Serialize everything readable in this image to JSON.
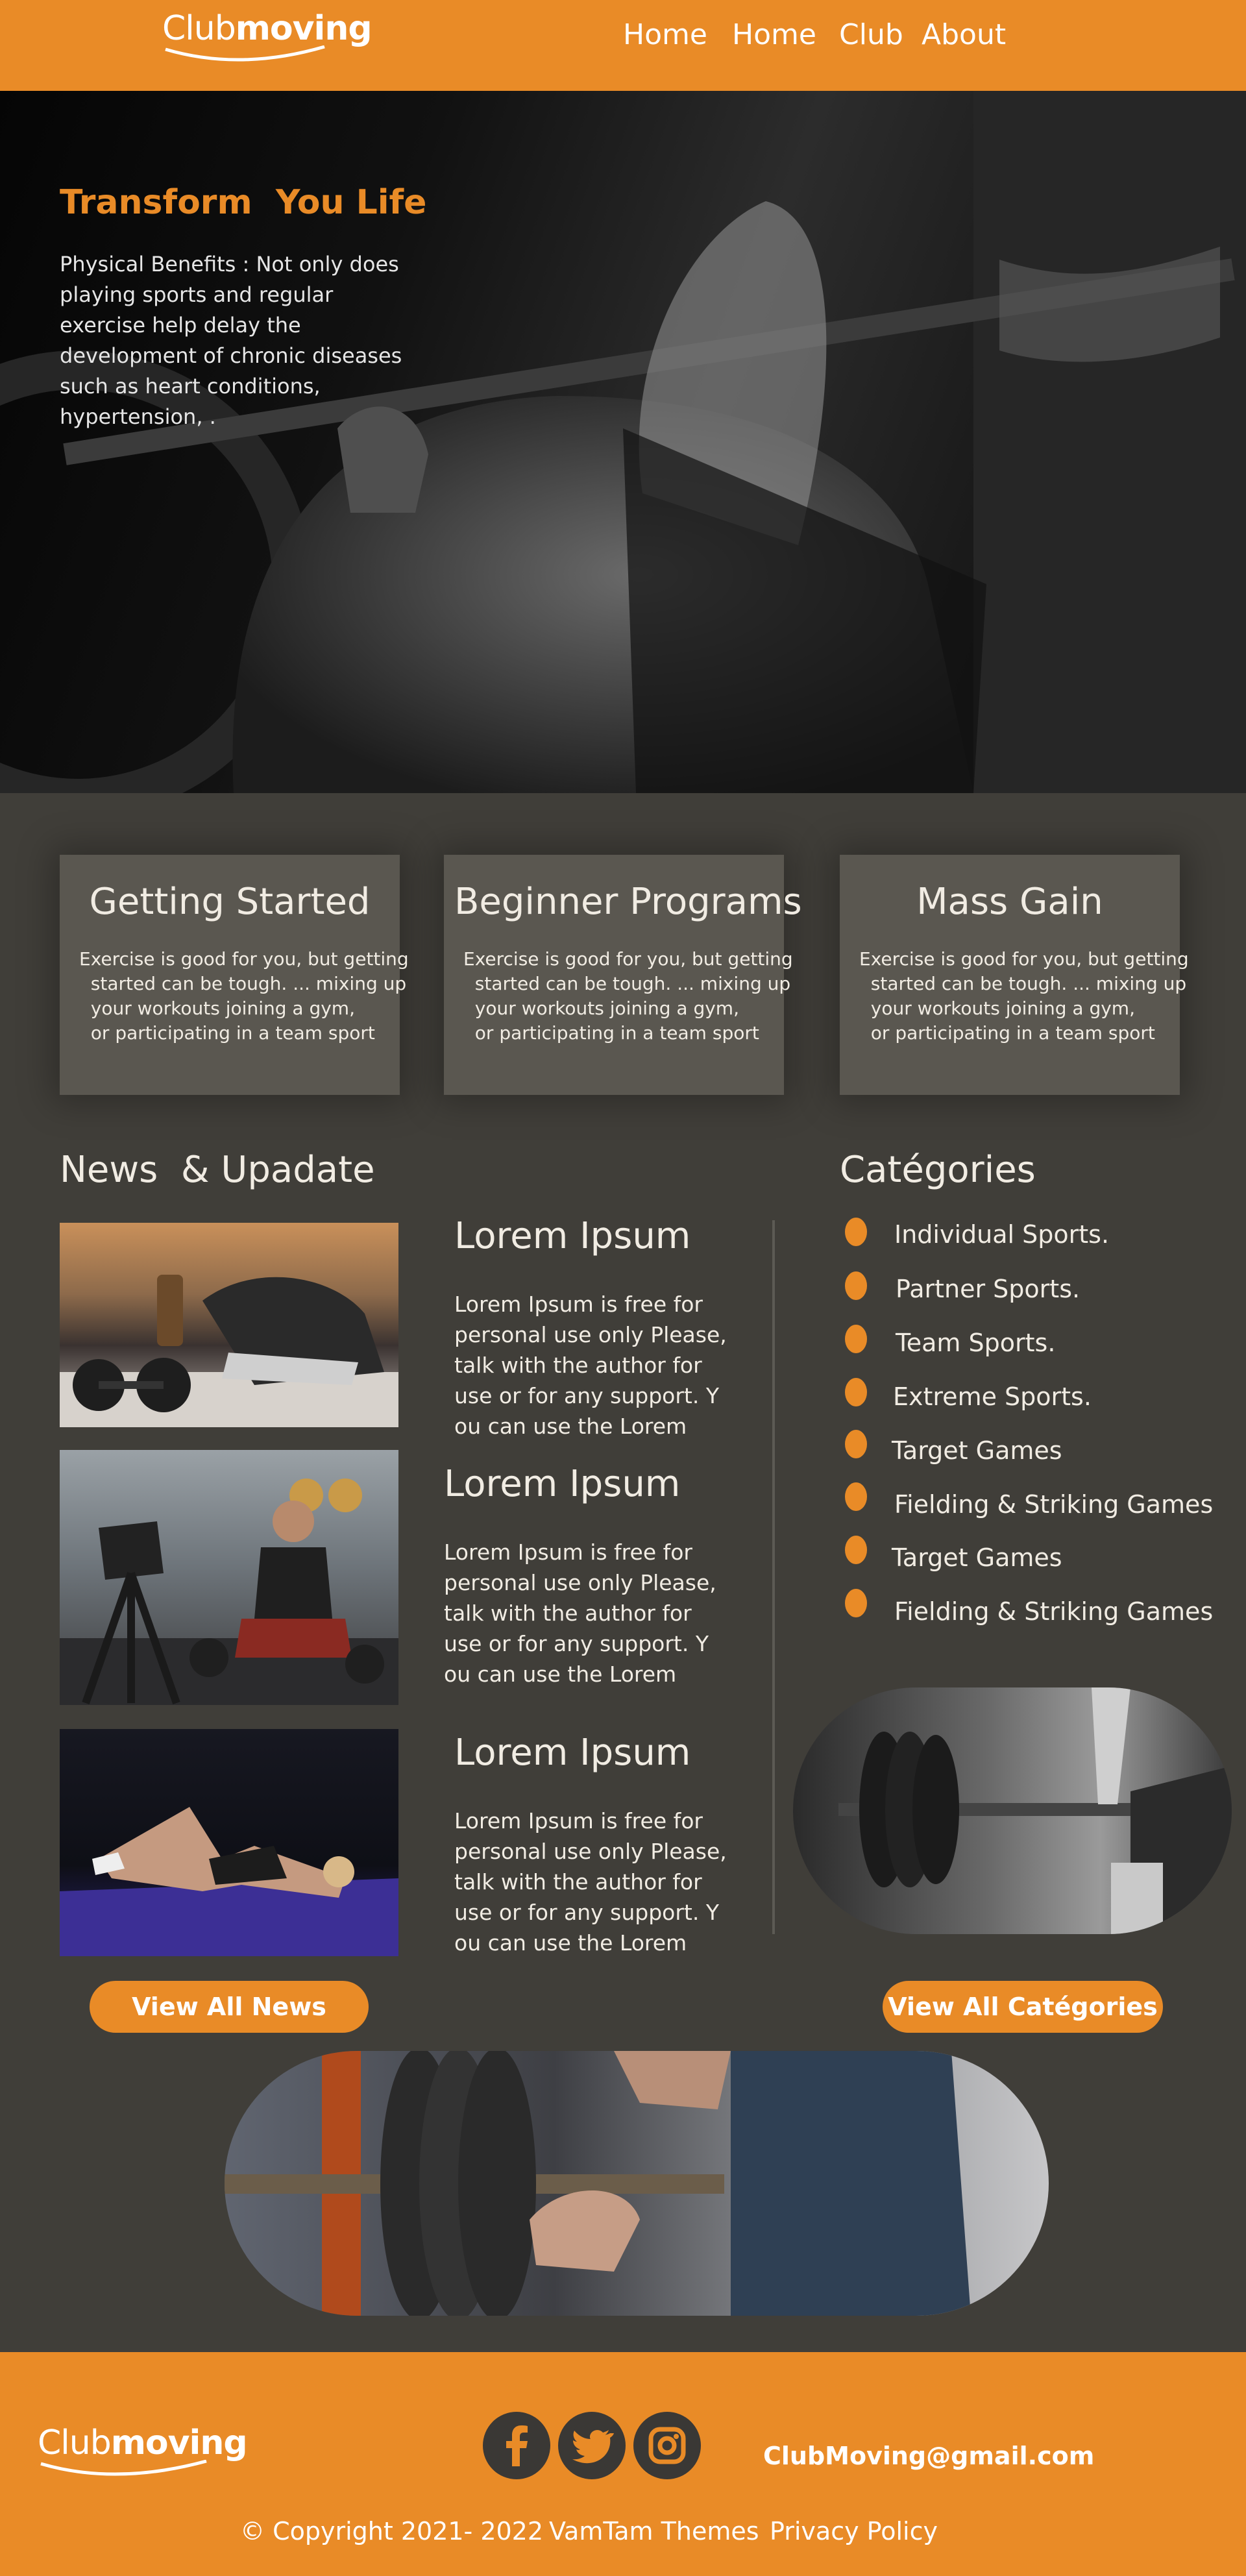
{
  "header": {
    "logo": {
      "thin": "Club",
      "bold": "moving"
    },
    "nav": [
      "Home",
      "Home",
      "Club",
      "About"
    ]
  },
  "hero": {
    "title": "Transform  You Life",
    "text": "Physical Benefits : Not only does playing sports and regular exercise help delay the development of chronic diseases such as heart conditions, hypertension, ."
  },
  "cards": [
    {
      "title": "Getting Started",
      "text": "Exercise is good for you, but getting\n  started can be tough. ... mixing up\n  your workouts joining a gym,\n  or participating in a team sport"
    },
    {
      "title": "Beginner Programs",
      "text": "Exercise is good for you, but getting\n  started can be tough. ... mixing up\n  your workouts joining a gym,\n  or participating in a team sport"
    },
    {
      "title": "Mass Gain",
      "text": "Exercise is good for you, but getting\n  started can be tough. ... mixing up\n  your workouts joining a gym,\n  or participating in a team sport"
    }
  ],
  "news": {
    "heading": "News  & Upadate",
    "items": [
      {
        "title": "Lorem Ipsum",
        "text": "Lorem Ipsum is free for personal use only Please, talk with the author for use or for any support. Y ou can use the Lorem"
      },
      {
        "title": "Lorem Ipsum",
        "text": "Lorem Ipsum is free for personal use only Please, talk with the author for use or for any support. Y ou can use the Lorem"
      },
      {
        "title": "Lorem Ipsum",
        "text": "Lorem Ipsum is free for personal use only Please, talk with the author for use or for any support. Y ou can use the Lorem"
      }
    ],
    "button": "View All News"
  },
  "categories": {
    "heading": "Catégories",
    "items": [
      "Individual Sports.",
      "Partner Sports.",
      "Team Sports.",
      "Extreme Sports.",
      "Target Games",
      "Fielding & Striking Games",
      "Target Games",
      "Fielding & Striking Games"
    ],
    "button": "View All Catégories"
  },
  "footer": {
    "logo": {
      "thin": "Club",
      "bold": "moving"
    },
    "social": [
      "facebook-icon",
      "twitter-icon",
      "instagram-icon"
    ],
    "email": "ClubMoving@gmail.com",
    "copyright": "© Copyright 2021- 2022",
    "themes": "VamTam Themes",
    "privacy": "Privacy Policy"
  },
  "colors": {
    "accent": "#e98b27",
    "background": "#403e39",
    "card": "#5a5750",
    "text": "#f1ece3"
  }
}
